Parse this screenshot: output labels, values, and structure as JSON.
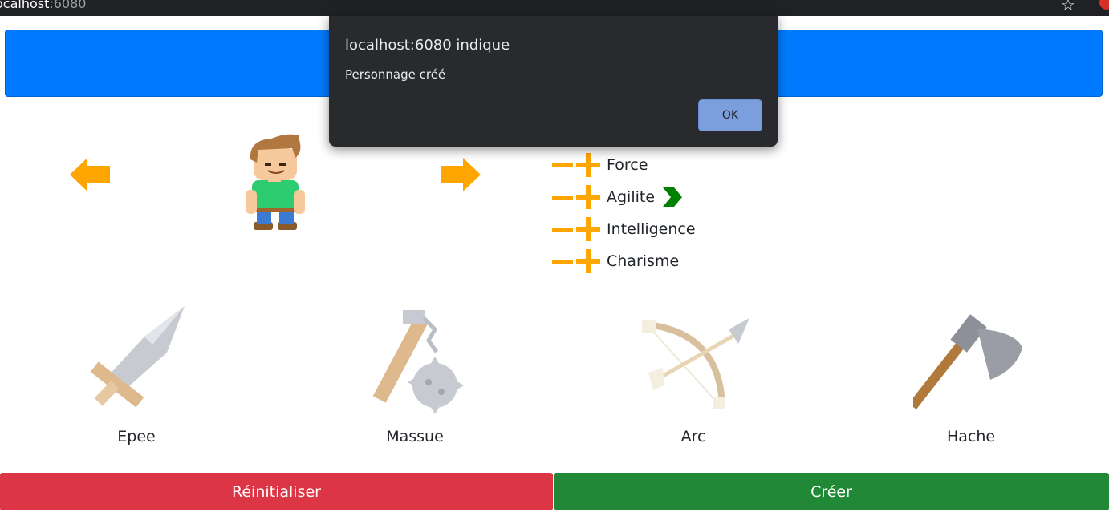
{
  "browser": {
    "host": "ocalhost",
    "port": ":6080"
  },
  "stats": [
    {
      "label": "Force"
    },
    {
      "label": "Agilite"
    },
    {
      "label": "Intelligence"
    },
    {
      "label": "Charisme"
    }
  ],
  "weapons": [
    {
      "label": "Epee"
    },
    {
      "label": "Massue"
    },
    {
      "label": "Arc"
    },
    {
      "label": "Hache"
    }
  ],
  "buttons": {
    "reset": "Réinitialiser",
    "create": "Créer"
  },
  "dialog": {
    "title": "localhost:6080 indique",
    "message": "Personnage créé",
    "ok": "OK"
  },
  "colors": {
    "banner": "#007bff",
    "accent": "#ffa500",
    "reset": "#dc3545",
    "create": "#218838",
    "selected_chevron": "#008000"
  }
}
